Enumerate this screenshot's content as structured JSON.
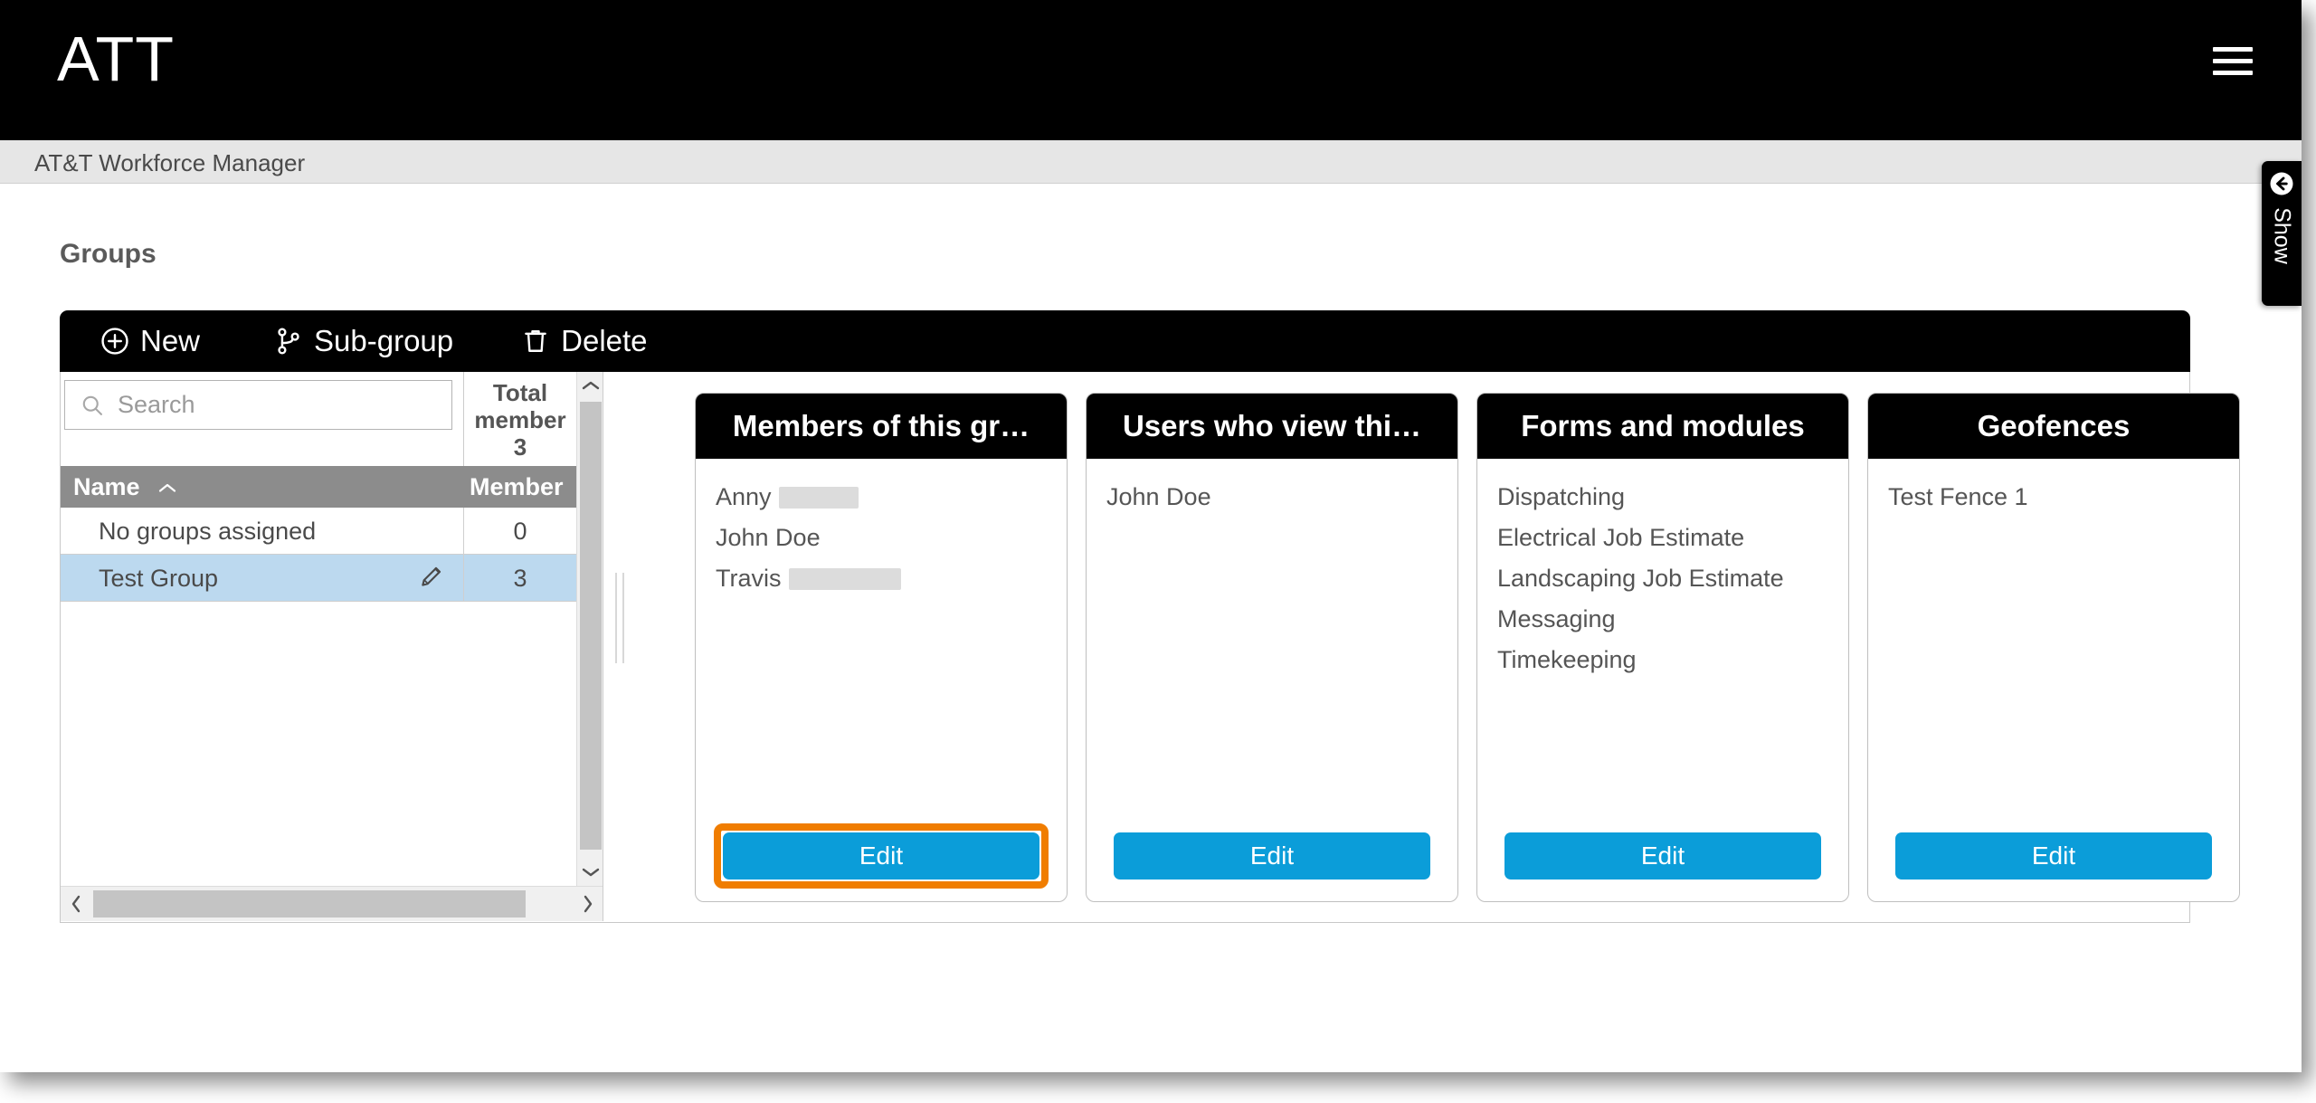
{
  "header": {
    "brand": "ATT",
    "menu_icon": "hamburger-icon",
    "sub_title": "AT&T Workforce Manager"
  },
  "page": {
    "title": "Groups"
  },
  "toolbar": {
    "new_label": "New",
    "subgroup_label": "Sub-group",
    "delete_label": "Delete"
  },
  "grid": {
    "search": {
      "value": "",
      "placeholder": "Search",
      "icon": "search-icon"
    },
    "total_header": {
      "line1": "Total",
      "line2": "member",
      "line3": "3"
    },
    "columns": [
      {
        "label": "Name",
        "sort": "ascending"
      },
      {
        "label": "Member"
      }
    ],
    "rows": [
      {
        "name": "No groups assigned",
        "member": "0",
        "selected": false,
        "has_edit": false
      },
      {
        "name": "Test Group",
        "member": "3",
        "selected": true,
        "has_edit": true
      }
    ]
  },
  "cards": [
    {
      "title": "Members of this gr…",
      "items": [
        {
          "text": "Anny",
          "redacted_width": 44
        },
        {
          "text": "John Doe",
          "redacted_width": 0
        },
        {
          "text": "Travis",
          "redacted_width": 62
        }
      ],
      "button_label": "Edit",
      "highlighted": true
    },
    {
      "title": "Users who view thi…",
      "items": [
        {
          "text": "John Doe",
          "redacted_width": 0
        }
      ],
      "button_label": "Edit",
      "highlighted": false
    },
    {
      "title": "Forms and modules",
      "items": [
        {
          "text": "Dispatching",
          "redacted_width": 0
        },
        {
          "text": "Electrical Job Estimate",
          "redacted_width": 0
        },
        {
          "text": "Landscaping Job Estimate",
          "redacted_width": 0
        },
        {
          "text": "Messaging",
          "redacted_width": 0
        },
        {
          "text": "Timekeeping",
          "redacted_width": 0
        }
      ],
      "button_label": "Edit",
      "highlighted": false
    },
    {
      "title": "Geofences",
      "items": [
        {
          "text": "Test Fence 1",
          "redacted_width": 0
        }
      ],
      "button_label": "Edit",
      "highlighted": false
    }
  ],
  "side_tab": {
    "label": "Show",
    "icon": "arrow-left-circle-icon"
  },
  "colors": {
    "accent_blue": "#0b9dd9",
    "highlight_orange": "#f07d00",
    "selected_row": "#bcd9ef",
    "header_gray": "#8c8c8c",
    "bar_black": "#000000"
  }
}
